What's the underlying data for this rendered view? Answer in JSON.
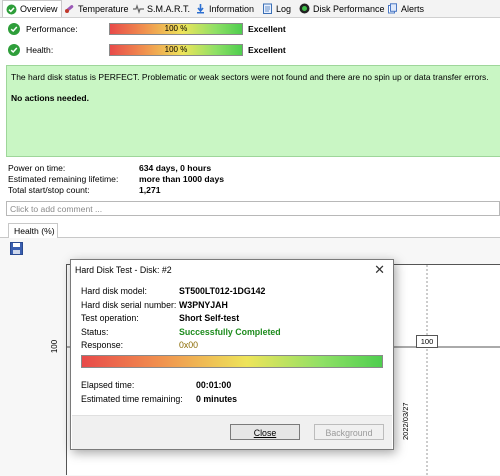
{
  "tabs": [
    {
      "label": "Overview",
      "icon": "check-circle-icon",
      "active": true
    },
    {
      "label": "Temperature",
      "icon": "thermometer-icon"
    },
    {
      "label": "S.M.A.R.T.",
      "icon": "heartbeat-icon"
    },
    {
      "label": "Information",
      "icon": "info-icon"
    },
    {
      "label": "Log",
      "icon": "log-icon"
    },
    {
      "label": "Disk Performance",
      "icon": "performance-icon"
    },
    {
      "label": "Alerts",
      "icon": "alerts-icon"
    }
  ],
  "status": {
    "performance": {
      "label": "Performance:",
      "percent_text": "100 %",
      "percent": 100,
      "rating": "Excellent"
    },
    "health": {
      "label": "Health:",
      "percent_text": "100 %",
      "percent": 100,
      "rating": "Excellent"
    }
  },
  "message": {
    "line1": "The hard disk status is PERFECT. Problematic or weak sectors were not found and there are no spin up or data transfer errors.",
    "line2": "No actions needed."
  },
  "stats": [
    {
      "label": "Power on time:",
      "value": "634 days, 0 hours"
    },
    {
      "label": "Estimated remaining lifetime:",
      "value": "more than 1000 days"
    },
    {
      "label": "Total start/stop count:",
      "value": "1,271"
    }
  ],
  "comment_placeholder": "Click to add comment ...",
  "health_tab": "Health (%)",
  "chart_data": {
    "type": "line",
    "ylabel_tick": "100",
    "point_label": "100",
    "x_tick": "2022/03/27"
  },
  "dialog": {
    "title": "Hard Disk Test - Disk: #2",
    "close": "✕",
    "rows": [
      {
        "label": "Hard disk model:",
        "value": "ST500LT012-1DG142"
      },
      {
        "label": "Hard disk serial number:",
        "value": "W3PNYJAH"
      },
      {
        "label": "Test operation:",
        "value": "Short Self-test"
      },
      {
        "label": "Status:",
        "value": "Successfully Completed"
      },
      {
        "label": "Response:",
        "value": "0x00"
      }
    ],
    "elapsed": {
      "label": "Elapsed time:",
      "value": "00:01:00"
    },
    "remaining": {
      "label": "Estimated time remaining:",
      "value": "0 minutes"
    },
    "close_button": "Close",
    "background_button": "Background",
    "colors": {
      "success": "#1e8c1e",
      "response": "#8a6a00"
    }
  }
}
